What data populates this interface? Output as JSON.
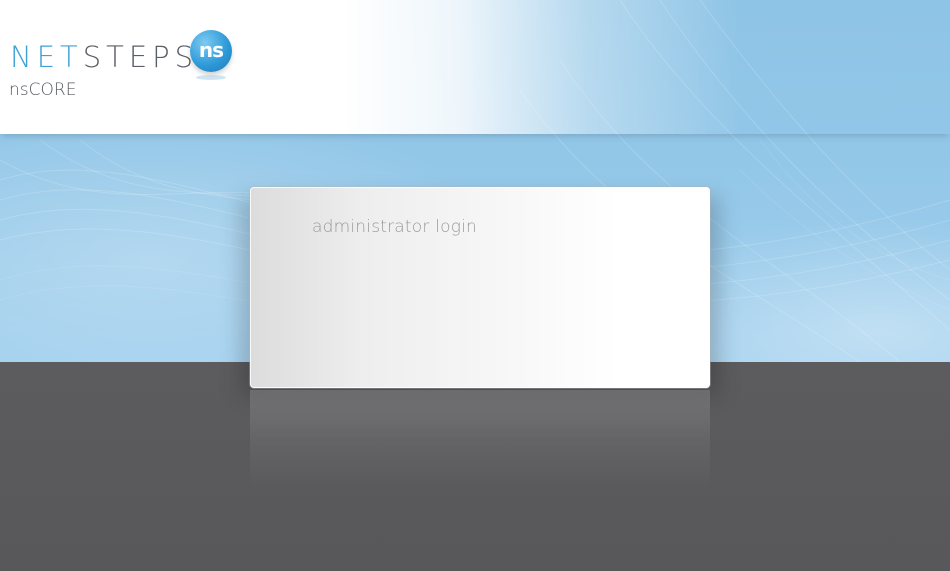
{
  "brand": {
    "logo_net": "NET",
    "logo_steps": "STEPS",
    "badge_text": "ns",
    "product_name": "nsCORE"
  },
  "login_panel": {
    "title": "administrator login"
  },
  "colors": {
    "brand_blue": "#3da2d6",
    "brand_gray": "#5a5f66",
    "sky_blue": "#93c7e8",
    "floor_gray": "#58585a"
  }
}
